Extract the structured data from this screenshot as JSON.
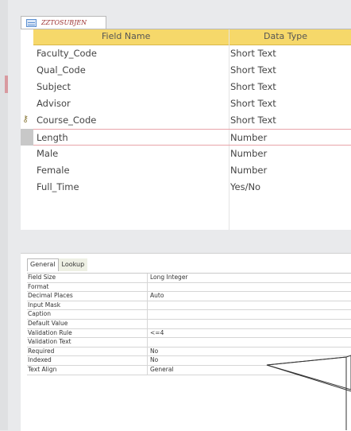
{
  "tab": {
    "label": "ZZTOSUBJEN",
    "icon": "table-design-icon"
  },
  "grid": {
    "header": {
      "field_name": "Field Name",
      "data_type": "Data Type"
    },
    "rows": [
      {
        "field": "Faculty_Code",
        "type": "Short Text"
      },
      {
        "field": "Qual_Code",
        "type": "Short Text"
      },
      {
        "field": "Subject",
        "type": "Short Text"
      },
      {
        "field": "Advisor",
        "type": "Short Text"
      },
      {
        "field": "Course_Code",
        "type": "Short Text",
        "key": true
      },
      {
        "field": "Length",
        "type": "Number",
        "selected": true
      },
      {
        "field": "Male",
        "type": "Number"
      },
      {
        "field": "Female",
        "type": "Number"
      },
      {
        "field": "Full_Time",
        "type": "Yes/No"
      }
    ]
  },
  "properties": {
    "tabs": [
      "General",
      "Lookup"
    ],
    "rows": [
      {
        "name": "Field Size",
        "value": "Long Integer"
      },
      {
        "name": "Format",
        "value": ""
      },
      {
        "name": "Decimal Places",
        "value": "Auto"
      },
      {
        "name": "Input Mask",
        "value": ""
      },
      {
        "name": "Caption",
        "value": ""
      },
      {
        "name": "Default Value",
        "value": ""
      },
      {
        "name": "Validation Rule",
        "value": "<=4"
      },
      {
        "name": "Validation Text",
        "value": ""
      },
      {
        "name": "Required",
        "value": "No"
      },
      {
        "name": "Indexed",
        "value": "No"
      },
      {
        "name": "Text Align",
        "value": "General"
      }
    ]
  }
}
